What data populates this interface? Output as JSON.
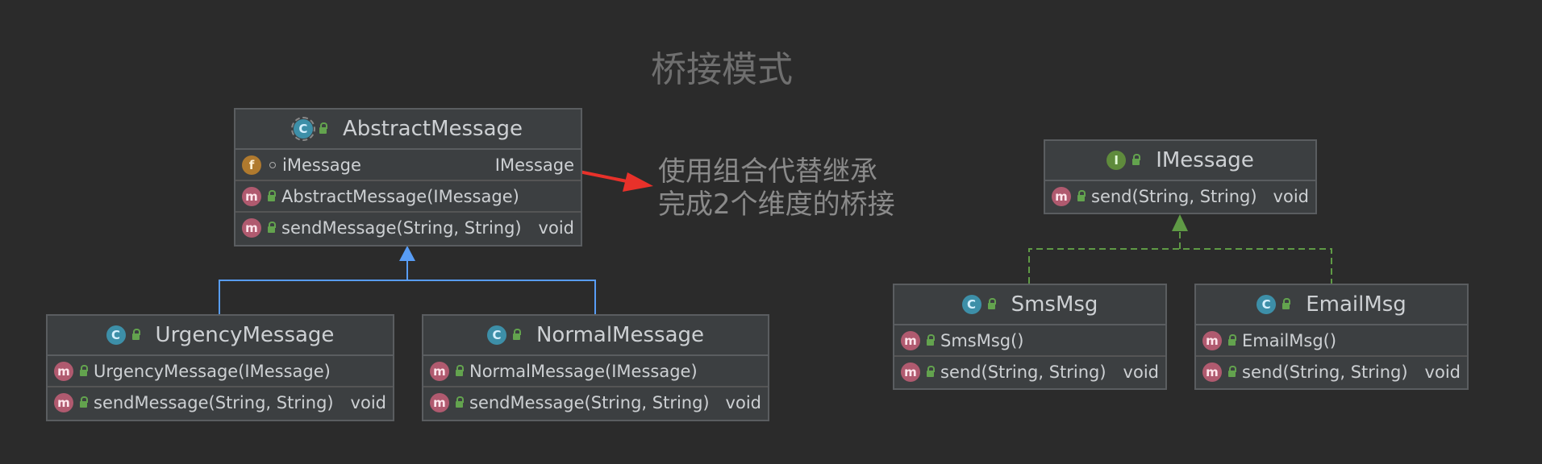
{
  "title": "桥接模式",
  "note": {
    "line1": "使用组合代替继承",
    "line2": "完成2个维度的桥接"
  },
  "classes": {
    "abstract_message": {
      "name": "AbstractMessage",
      "field_name": "iMessage",
      "field_type": "IMessage",
      "method1": "AbstractMessage(IMessage)",
      "method2": "sendMessage(String, String)",
      "method2_type": "void"
    },
    "urgency_message": {
      "name": "UrgencyMessage",
      "method1": "UrgencyMessage(IMessage)",
      "method2": "sendMessage(String, String)",
      "method2_type": "void"
    },
    "normal_message": {
      "name": "NormalMessage",
      "method1": "NormalMessage(IMessage)",
      "method2": "sendMessage(String, String)",
      "method2_type": "void"
    },
    "imessage": {
      "name": "IMessage",
      "method1": "send(String, String)",
      "method1_type": "void"
    },
    "sms_msg": {
      "name": "SmsMsg",
      "method1": "SmsMsg()",
      "method2": "send(String, String)",
      "method2_type": "void"
    },
    "email_msg": {
      "name": "EmailMsg",
      "method1": "EmailMsg()",
      "method2": "send(String, String)",
      "method2_type": "void"
    }
  },
  "badges": {
    "class": "C",
    "interface": "I",
    "method": "m",
    "field": "f"
  },
  "colors": {
    "background": "#2b2b2b",
    "inheritance_arrow": "#589df6",
    "implementation_arrow": "#5f9a45",
    "annotation_arrow": "#e8312a"
  }
}
